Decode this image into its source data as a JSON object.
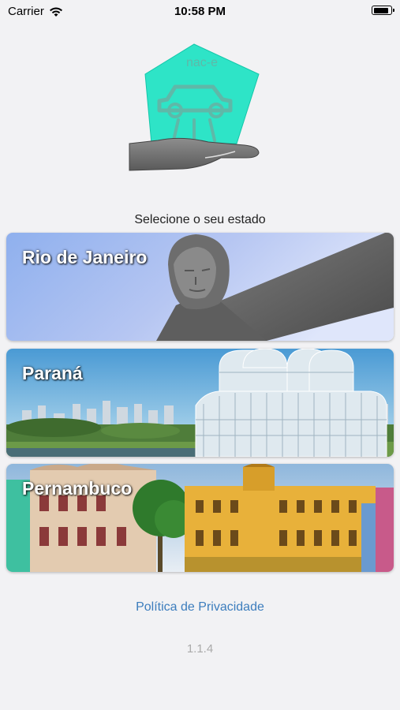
{
  "status_bar": {
    "carrier": "Carrier",
    "time": "10:58 PM",
    "battery_level": 0.9
  },
  "logo": {
    "text": "nac-e",
    "accent_color": "#1de3c2",
    "icon": "hand-holding-car-logo"
  },
  "prompt": "Selecione o seu estado",
  "states": [
    {
      "label": "Rio de Janeiro",
      "image": "christ-the-redeemer-photo"
    },
    {
      "label": "Paraná",
      "image": "curitiba-botanical-garden-photo"
    },
    {
      "label": "Pernambuco",
      "image": "recife-colonial-buildings-photo"
    }
  ],
  "privacy_link": "Política de Privacidade",
  "version": "1.1.4",
  "colors": {
    "background": "#f2f2f4",
    "link": "#3c7dbd",
    "version": "#aaaaaa"
  }
}
